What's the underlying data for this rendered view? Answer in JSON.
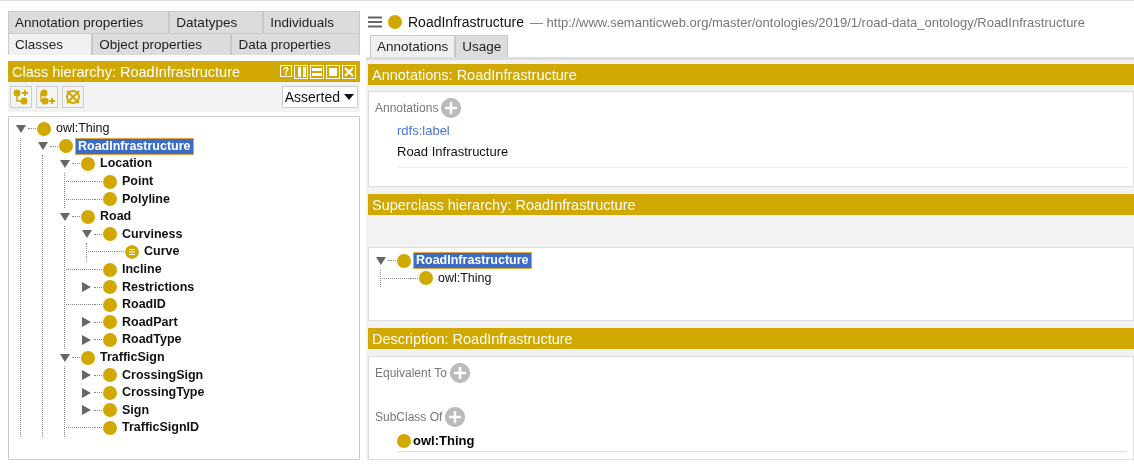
{
  "left_panel": {
    "tab_rows": [
      [
        {
          "label": "Annotation properties",
          "selected": false
        },
        {
          "label": "Datatypes",
          "selected": false
        },
        {
          "label": "Individuals",
          "selected": false
        }
      ],
      [
        {
          "label": "Classes",
          "selected": true
        },
        {
          "label": "Object properties",
          "selected": false
        },
        {
          "label": "Data properties",
          "selected": false
        }
      ]
    ],
    "class_hierarchy": {
      "title": "Class hierarchy: RoadInfrastructure",
      "help_button": "?",
      "view_mode": "Asserted",
      "tree": [
        {
          "label": "owl:Thing",
          "kind": "thing",
          "expanded": true,
          "selected": false,
          "children": [
            {
              "label": "RoadInfrastructure",
              "kind": "class",
              "expanded": true,
              "selected": true,
              "children": [
                {
                  "label": "Location",
                  "kind": "class",
                  "expanded": true,
                  "selected": false,
                  "children": [
                    {
                      "label": "Point",
                      "kind": "class",
                      "selected": false
                    },
                    {
                      "label": "Polyline",
                      "kind": "class",
                      "selected": false
                    }
                  ]
                },
                {
                  "label": "Road",
                  "kind": "class",
                  "expanded": true,
                  "selected": false,
                  "children": [
                    {
                      "label": "Curviness",
                      "kind": "class",
                      "expanded": true,
                      "selected": false,
                      "children": [
                        {
                          "label": "Curve",
                          "kind": "defined",
                          "selected": false
                        }
                      ]
                    },
                    {
                      "label": "Incline",
                      "kind": "class",
                      "selected": false
                    },
                    {
                      "label": "Restrictions",
                      "kind": "class",
                      "expanded": false,
                      "selected": false
                    },
                    {
                      "label": "RoadID",
                      "kind": "class",
                      "selected": false
                    },
                    {
                      "label": "RoadPart",
                      "kind": "class",
                      "expanded": false,
                      "selected": false
                    },
                    {
                      "label": "RoadType",
                      "kind": "class",
                      "expanded": false,
                      "selected": false
                    }
                  ]
                },
                {
                  "label": "TrafficSign",
                  "kind": "class",
                  "expanded": true,
                  "selected": false,
                  "children": [
                    {
                      "label": "CrossingSign",
                      "kind": "class",
                      "expanded": false,
                      "selected": false
                    },
                    {
                      "label": "CrossingType",
                      "kind": "class",
                      "expanded": false,
                      "selected": false
                    },
                    {
                      "label": "Sign",
                      "kind": "class",
                      "expanded": false,
                      "selected": false
                    },
                    {
                      "label": "TrafficSignID",
                      "kind": "class",
                      "selected": false
                    }
                  ]
                }
              ]
            }
          ]
        }
      ]
    }
  },
  "entity": {
    "name": "RoadInfrastructure",
    "iri": "— http://www.semanticweb.org/master/ontologies/2019/1/road-data_ontology/RoadInfrastructure"
  },
  "right_tabs": [
    {
      "label": "Annotations",
      "selected": true
    },
    {
      "label": "Usage",
      "selected": false
    }
  ],
  "annotations": {
    "title": "Annotations: RoadInfrastructure",
    "section_label": "Annotations",
    "items": [
      {
        "property": "rdfs:label",
        "value": "Road Infrastructure"
      }
    ]
  },
  "superclass_hierarchy": {
    "title": "Superclass hierarchy: RoadInfrastructure",
    "tree": [
      {
        "label": "RoadInfrastructure",
        "kind": "class",
        "expanded": true,
        "selected": true,
        "children": [
          {
            "label": "owl:Thing",
            "kind": "thing",
            "selected": false
          }
        ]
      }
    ]
  },
  "description": {
    "title": "Description: RoadInfrastructure",
    "sections": [
      {
        "label": "Equivalent To"
      },
      {
        "label": "SubClass Of",
        "items": [
          {
            "label": "owl:Thing"
          }
        ]
      }
    ]
  }
}
